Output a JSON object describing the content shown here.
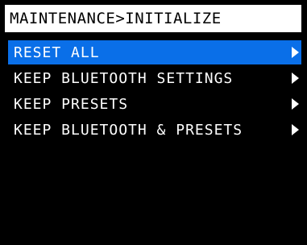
{
  "header": {
    "title": "MAINTENANCE>INITIALIZE"
  },
  "menu": {
    "items": [
      {
        "label": "RESET ALL",
        "selected": true,
        "icon": "chevron-right-icon"
      },
      {
        "label": "KEEP BLUETOOTH SETTINGS",
        "selected": false,
        "icon": "chevron-right-icon"
      },
      {
        "label": "KEEP PRESETS",
        "selected": false,
        "icon": "chevron-right-icon"
      },
      {
        "label": "KEEP BLUETOOTH & PRESETS",
        "selected": false,
        "icon": "chevron-right-icon"
      }
    ]
  },
  "colors": {
    "background": "#000000",
    "title_bar": "#ffffff",
    "selection": "#0a6fe8",
    "text": "#ffffff"
  }
}
